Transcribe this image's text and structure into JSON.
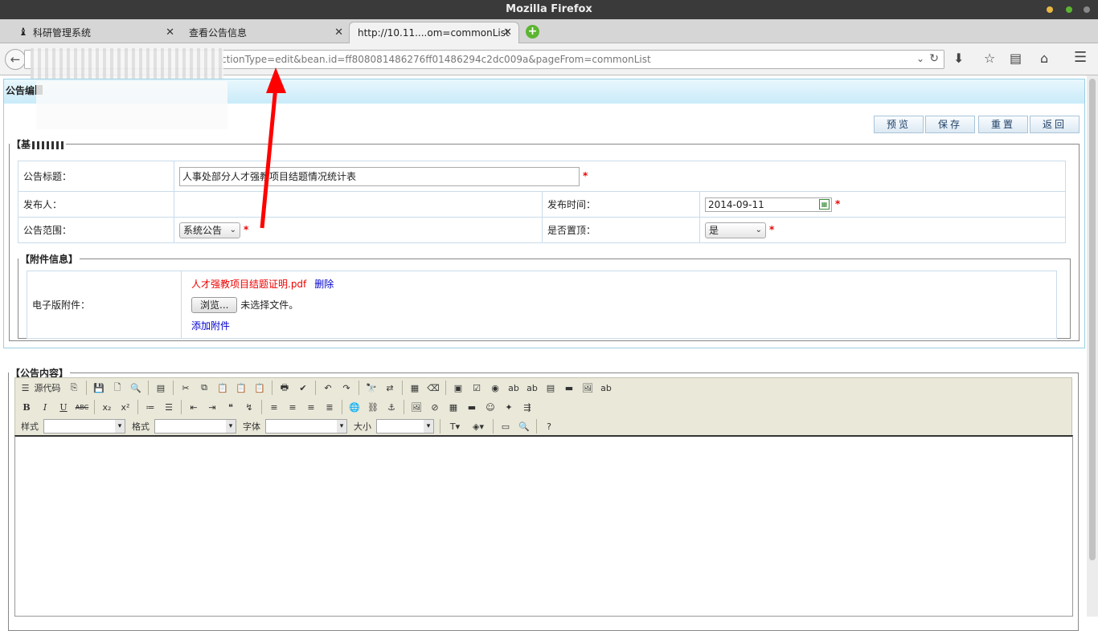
{
  "window": {
    "title": "Mozilla Firefox"
  },
  "tabs": [
    {
      "label": "科研管理系统",
      "icon": "academic-cap-icon"
    },
    {
      "label": "查看公告信息"
    },
    {
      "label": "http://10.11....om=commonList"
    }
  ],
  "url": {
    "visible": "ctionType=edit&bean.id=ff808081486276ff01486294c2dc009a&pageFrom=commonList"
  },
  "panel": {
    "title": "公告编"
  },
  "buttons": {
    "preview": "预览",
    "save": "保存",
    "reset": "重置",
    "back": "返回"
  },
  "basic": {
    "legend": "【基",
    "title_label": "公告标题：",
    "title_value": "人事处部分人才强教项目结题情况统计表",
    "publisher_label": "发布人：",
    "publisher_value": "",
    "pubtime_label": "发布时间：",
    "pubtime_value": "2014-09-11",
    "scope_label": "公告范围：",
    "scope_value": "系统公告",
    "top_label": "是否置顶：",
    "top_value": "是"
  },
  "attach": {
    "legend": "【附件信息】",
    "label": "电子版附件：",
    "file_name": "人才强教项目结题证明.pdf",
    "delete": "删除",
    "browse": "浏览...",
    "no_file": "未选择文件。",
    "add": "添加附件"
  },
  "content": {
    "legend": "【公告内容】",
    "source_btn": "源代码",
    "style_label": "样式",
    "format_label": "格式",
    "font_label": "字体",
    "size_label": "大小"
  }
}
